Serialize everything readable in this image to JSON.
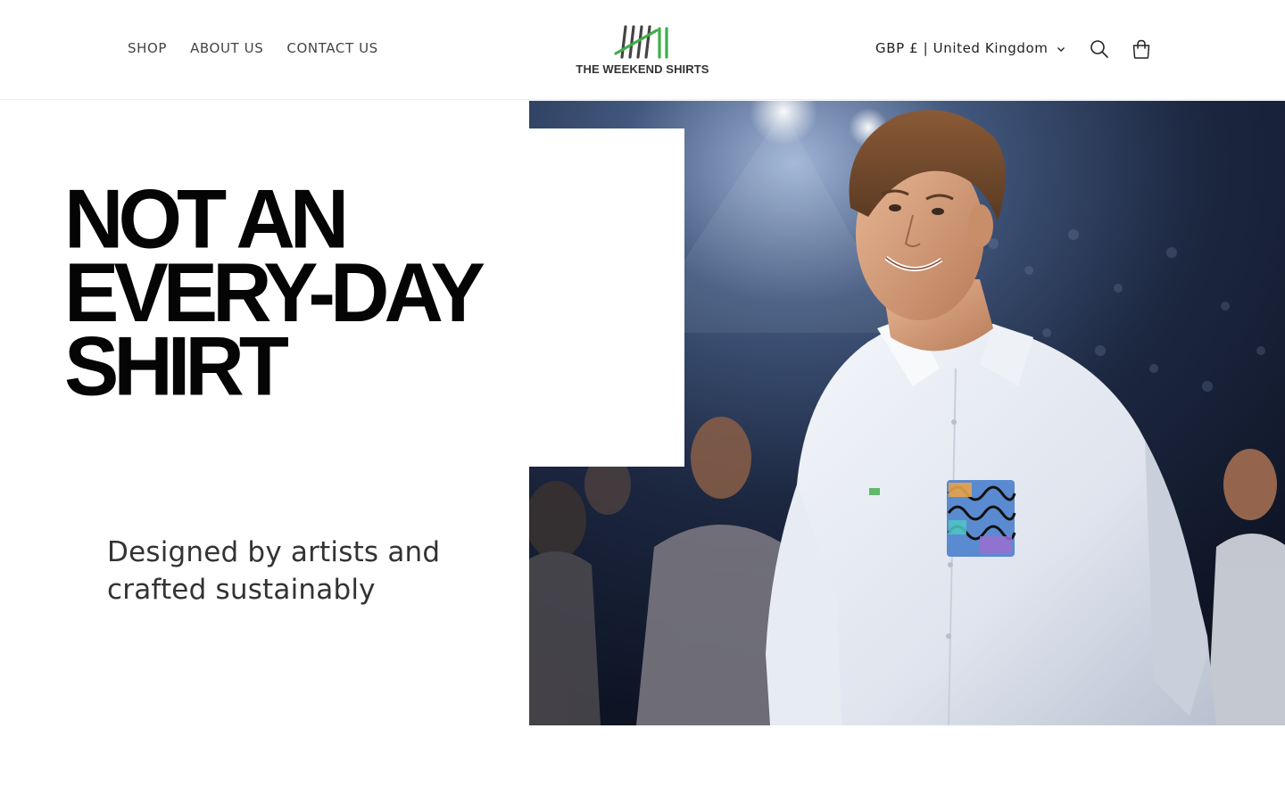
{
  "header": {
    "nav": [
      {
        "label": "SHOP"
      },
      {
        "label": "ABOUT US"
      },
      {
        "label": "CONTACT US"
      }
    ],
    "logo": {
      "text": "THE WEEKEND SHIRTS",
      "icon": "tally-marks-logo",
      "colors": {
        "dark": "#444444",
        "green": "#3fae49"
      }
    },
    "locale_selector": {
      "label": "GBP £ | United Kingdom",
      "icon": "chevron-down-icon"
    },
    "search_icon": "search-icon",
    "cart_icon": "cart-icon"
  },
  "hero": {
    "headline_lines": [
      "NOT AN",
      "EVERY-DAY",
      "SHIRT"
    ],
    "tagline_lines": [
      "Designed by artists and",
      "crafted sustainably"
    ],
    "image": "young man in white shirt with colorful artistic pocket print smiling at a night event with crowd behind"
  }
}
